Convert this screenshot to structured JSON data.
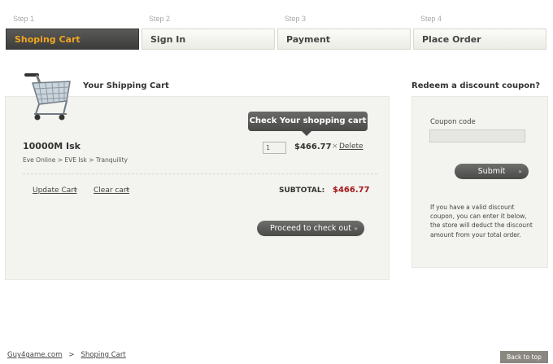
{
  "steps": [
    {
      "num": "Step 1",
      "label": "Shoping Cart",
      "active": true
    },
    {
      "num": "Step 2",
      "label": "Sign In",
      "active": false
    },
    {
      "num": "Step 3",
      "label": "Payment",
      "active": false
    },
    {
      "num": "Step 4",
      "label": "Place Order",
      "active": false
    }
  ],
  "cart": {
    "title": "Your Shipping Cart",
    "tooltip": "Check Your shopping cart",
    "item": {
      "name": "10000M Isk",
      "path": "Eve Online > EVE Isk > Tranquility",
      "quantity": "1",
      "price": "$466.77",
      "delete_x": "×",
      "delete_label": "Delete"
    },
    "update_label": "Update Cart",
    "clear_label": "Clear cart",
    "link_arrow": "»",
    "subtotal_label": "SUBTOTAL:",
    "subtotal_value": "$466.77",
    "checkout_label": "Proceed to check out",
    "checkout_arrow": "»"
  },
  "coupon": {
    "heading": "Redeem a discount coupon?",
    "field_label": "Coupon code",
    "field_value": "",
    "submit_label": "Submit",
    "submit_arrow": "»",
    "help": "If you have a valid discount coupon, you can enter it below, the store will deduct the discount amount from your total order."
  },
  "footer": {
    "breadcrumb_home": "Guy4game.com",
    "breadcrumb_sep": ">",
    "breadcrumb_current": "Shoping Cart",
    "back_to_top": "Back to top"
  },
  "colors": {
    "accent_orange": "#f0a520",
    "price_red": "#a01818",
    "panel_bg": "#f3f3ef",
    "button_dark": "#4a4a48"
  },
  "icons": {
    "cart": "shopping-cart-icon"
  }
}
